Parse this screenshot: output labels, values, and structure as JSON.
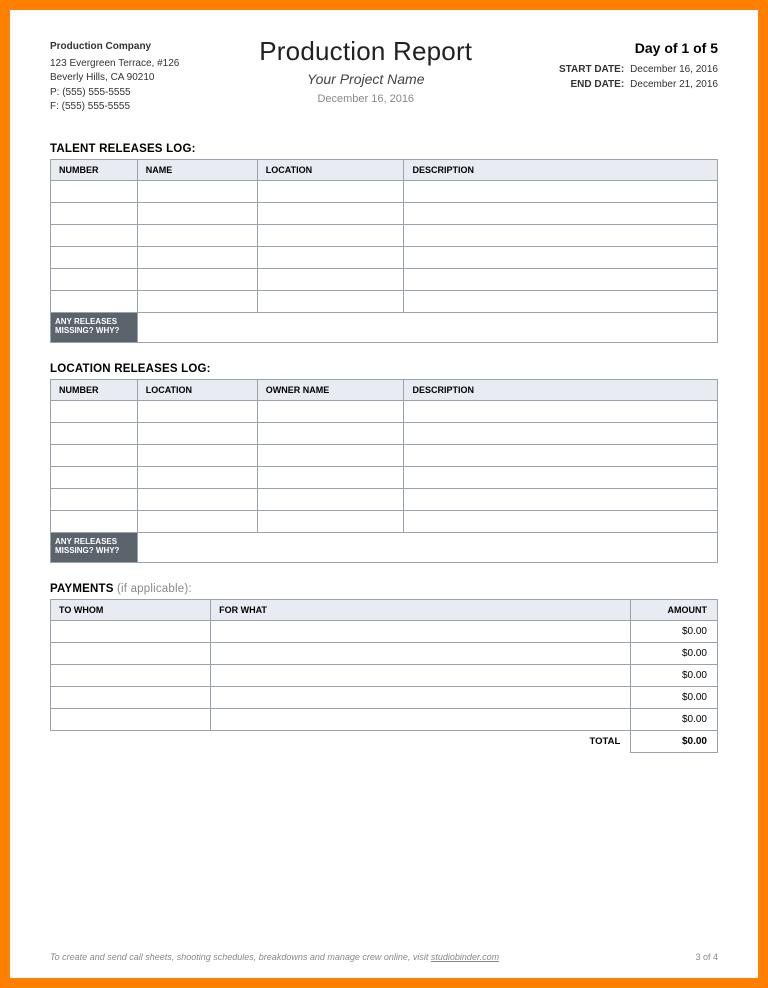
{
  "company": {
    "name": "Production Company",
    "address1": "123 Evergreen Terrace, #126",
    "address2": "Beverly Hills, CA 90210",
    "phone": "P: (555) 555-5555",
    "fax": "F: (555) 555-5555"
  },
  "title": {
    "main": "Production Report",
    "subtitle": "Your Project Name",
    "date": "December 16, 2016"
  },
  "header_right": {
    "day_of": "Day of 1 of 5",
    "start_label": "START DATE:",
    "start_date": "December 16, 2016",
    "end_label": "END DATE:",
    "end_date": "December 21, 2016"
  },
  "talent": {
    "heading": "TALENT RELEASES LOG:",
    "headers": {
      "number": "NUMBER",
      "name": "NAME",
      "location": "LOCATION",
      "description": "DESCRIPTION"
    },
    "missing_label_1": "ANY RELEASES",
    "missing_label_2": "MISSING? WHY?"
  },
  "location": {
    "heading": "LOCATION RELEASES LOG:",
    "headers": {
      "number": "NUMBER",
      "location": "LOCATION",
      "owner": "OWNER NAME",
      "description": "DESCRIPTION"
    },
    "missing_label_1": "ANY RELEASES",
    "missing_label_2": "MISSING? WHY?"
  },
  "payments": {
    "heading": "PAYMENTS",
    "heading_muted": "  (if applicable):",
    "headers": {
      "to_whom": "TO WHOM",
      "for_what": "FOR WHAT",
      "amount": "AMOUNT"
    },
    "rows": [
      "$0.00",
      "$0.00",
      "$0.00",
      "$0.00",
      "$0.00"
    ],
    "total_label": "TOTAL",
    "total_value": "$0.00"
  },
  "footer": {
    "text_pre": "To create and send call sheets, shooting schedules, breakdowns and manage crew online, visit ",
    "link": "studiobinder.com",
    "page": "3 of 4"
  }
}
